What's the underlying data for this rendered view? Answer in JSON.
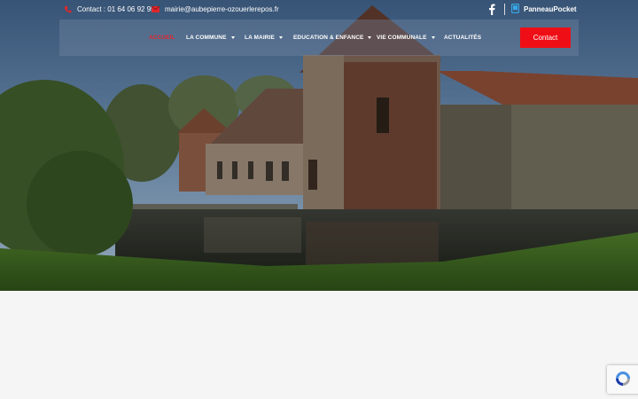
{
  "topbar": {
    "phone_text": "Contact : 01 64 06 92 95",
    "email_text": "mairie@aubepierre-ozouerlerepos.fr",
    "panneau_label": "PanneauPocket"
  },
  "nav": {
    "items": [
      {
        "label": "ACCUEIL",
        "active": true,
        "dropdown": false
      },
      {
        "label": "LA COMMUNE",
        "active": false,
        "dropdown": true
      },
      {
        "label": "LA MAIRIE",
        "active": false,
        "dropdown": true
      },
      {
        "label": "EDUCATION & ENFANCE",
        "active": false,
        "dropdown": true
      },
      {
        "label": "VIE COMMUNALE",
        "active": false,
        "dropdown": true
      },
      {
        "label": "ACTUALITÉS",
        "active": false,
        "dropdown": false
      }
    ],
    "contact_button": "Contact"
  },
  "colors": {
    "accent": "#ef0e16",
    "active_nav": "#e1262b"
  },
  "icons": [
    "phone-icon",
    "mail-icon",
    "facebook-icon",
    "panneaupocket-icon",
    "chevron-down-icon",
    "recaptcha-icon"
  ]
}
